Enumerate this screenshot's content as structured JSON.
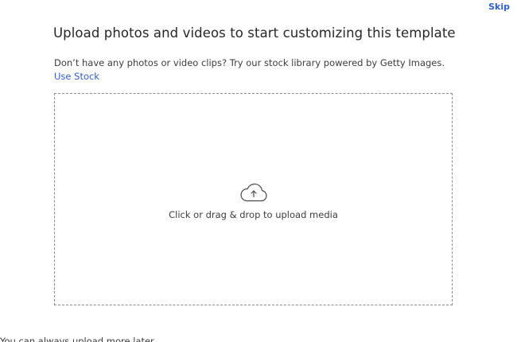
{
  "header": {
    "skip_label": "Skip",
    "title": "Upload photos and videos to start customizing this template"
  },
  "stock": {
    "message": "Don’t have any photos or video clips? Try our stock library powered by Getty Images.",
    "link_label": "Use Stock"
  },
  "dropzone": {
    "icon": "cloud-upload-icon",
    "label": "Click or drag & drop to upload media"
  },
  "footer": {
    "note": "You can always upload more later"
  },
  "colors": {
    "link": "#2f5fd0",
    "text": "#262626",
    "border": "#8a8a8a"
  }
}
